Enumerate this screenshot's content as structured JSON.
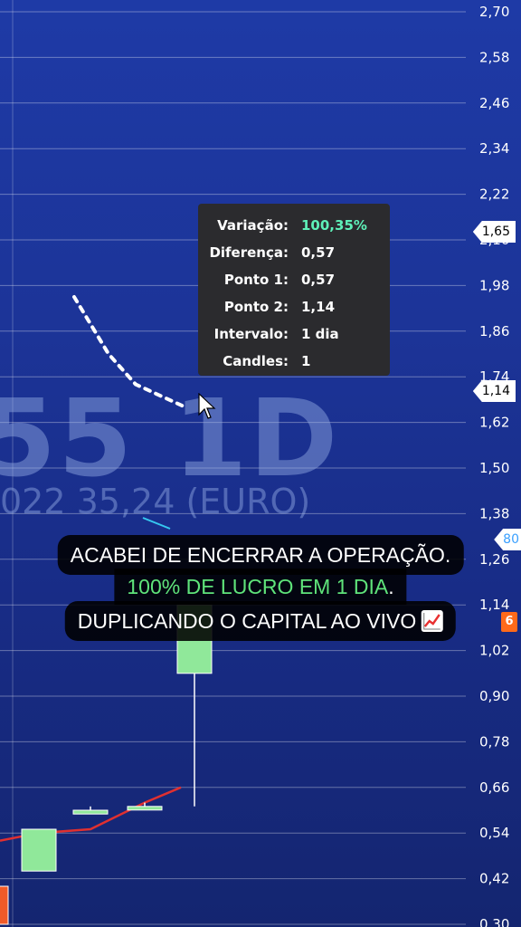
{
  "y_axis": {
    "labels": [
      "2,70",
      "2,58",
      "2,46",
      "2,34",
      "2,22",
      "2,10",
      "1,98",
      "1,86",
      "1,74",
      "1,62",
      "1,50",
      "1,38",
      "1,26",
      "1,14",
      "1,02",
      "0,90",
      "0,78",
      "0,66",
      "0,54",
      "0,42",
      "0,30"
    ]
  },
  "price_tags": {
    "top": "1,65",
    "mid": "1,14",
    "low": "80",
    "orange": "6"
  },
  "watermark": {
    "big": "55 1D",
    "small": "022 35,24 (EURO)"
  },
  "tooltip": {
    "rows": [
      {
        "key": "Variação:",
        "value": "100,35%",
        "color": "green"
      },
      {
        "key": "Diferença:",
        "value": "0,57"
      },
      {
        "key": "Ponto 1:",
        "value": "0,57"
      },
      {
        "key": "Ponto 2:",
        "value": "1,14"
      },
      {
        "key": "Intervalo:",
        "value": "1 dia"
      },
      {
        "key": "Candles:",
        "value": "1"
      }
    ]
  },
  "caption": {
    "line1": "ACABEI DE ENCERRAR A OPERAÇÃO.",
    "line2_green": "100% DE LUCRO EM 1 DIA",
    "line2_tail": ".",
    "line3": "DUPLICANDO O CAPITAL AO VIVO",
    "emoji": "chart-increasing-icon"
  },
  "colors": {
    "bull": "#90e89a",
    "bear": "#f05a28",
    "ma_line": "#e03030",
    "tooltip_bg": "#2b2b2e",
    "positive": "#5ef0b8"
  },
  "chart_data": {
    "type": "candlestick",
    "ylim": [
      0.3,
      2.7
    ],
    "candles": [
      {
        "open": 0.3,
        "close": 0.4,
        "high": 0.4,
        "low": 0.3,
        "color": "bear"
      },
      {
        "open": 0.44,
        "close": 0.55,
        "high": 0.55,
        "low": 0.44,
        "color": "bull"
      },
      {
        "open": 0.59,
        "close": 0.6,
        "high": 0.61,
        "low": 0.59,
        "color": "bull"
      },
      {
        "open": 0.61,
        "close": 0.61,
        "high": 0.62,
        "low": 0.6,
        "color": "bull"
      },
      {
        "open": 0.96,
        "close": 1.14,
        "high": 1.14,
        "low": 0.61,
        "color": "bull"
      }
    ],
    "moving_average": [
      0.52,
      0.54,
      0.55,
      0.62,
      0.66
    ],
    "dotted_trend": [
      1.95,
      1.8,
      1.72,
      1.66
    ]
  }
}
